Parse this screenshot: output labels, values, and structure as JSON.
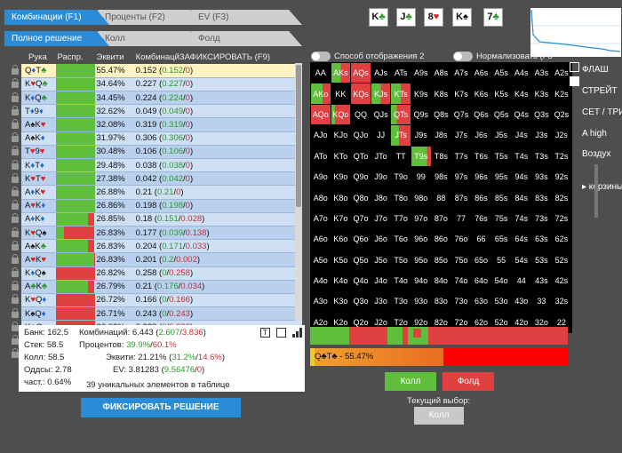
{
  "tabs": {
    "main": [
      {
        "label": "Комбинации (F1)",
        "active": true
      },
      {
        "label": "Проценты (F2)",
        "active": false
      },
      {
        "label": "EV (F3)",
        "active": false
      }
    ],
    "sub": [
      {
        "label": "Полное решение",
        "active": true
      },
      {
        "label": "Колл",
        "active": false
      },
      {
        "label": "Фолд",
        "active": false
      }
    ]
  },
  "board": [
    {
      "rank": "K",
      "suit": "♣",
      "color": "#2a9a2a"
    },
    {
      "rank": "J",
      "suit": "♣",
      "color": "#2a9a2a"
    },
    {
      "rank": "8",
      "suit": "♥",
      "color": "#d22"
    },
    {
      "rank": "K",
      "suit": "♠",
      "color": "#111"
    },
    {
      "rank": "7",
      "suit": "♣",
      "color": "#2a9a2a"
    }
  ],
  "table": {
    "headers": [
      "Рука",
      "Распр.",
      "Эквити",
      "КомбинацйЗАФИКСИРОВАТЬ (F9)"
    ],
    "rows": [
      [
        "Q♦T♣",
        "55.47%",
        "0.152",
        "0.152",
        "0",
        1.0,
        0
      ],
      [
        "K♥Q♣",
        "34.64%",
        "0.227",
        "0.227",
        "0",
        1.0,
        0
      ],
      [
        "K♦Q♣",
        "34.45%",
        "0.224",
        "0.224",
        "0",
        1.0,
        0
      ],
      [
        "T♦9♦",
        "32.62%",
        "0.049",
        "0.049",
        "0",
        1.0,
        0
      ],
      [
        "A♠K♥",
        "32.08%",
        "0.319",
        "0.319",
        "0",
        1.0,
        0
      ],
      [
        "A♠K♦",
        "31.97%",
        "0.306",
        "0.306",
        "0",
        1.0,
        0
      ],
      [
        "T♥9♥",
        "30.48%",
        "0.106",
        "0.106",
        "0",
        1.0,
        0
      ],
      [
        "K♦T♦",
        "29.48%",
        "0.038",
        "0.038",
        "0",
        1.0,
        0
      ],
      [
        "K♥T♥",
        "27.38%",
        "0.042",
        "0.042",
        "0",
        1.0,
        0
      ],
      [
        "A♦K♥",
        "26.88%",
        "0.21",
        "0.21",
        "0",
        1.0,
        0
      ],
      [
        "A♥K♦",
        "26.86%",
        "0.198",
        "0.198",
        "0",
        1.0,
        0
      ],
      [
        "A♦K♦",
        "26.85%",
        "0.18",
        "0.151",
        "0.028",
        0.84,
        0.16
      ],
      [
        "K♥Q♠",
        "26.83%",
        "0.177",
        "0.039",
        "0.138",
        0.22,
        0.78
      ],
      [
        "A♠K♣",
        "26.83%",
        "0.204",
        "0.171",
        "0.033",
        0.84,
        0.16
      ],
      [
        "A♥K♥",
        "26.83%",
        "0.201",
        "0.2",
        "0.002",
        0.99,
        0.01
      ],
      [
        "K♦Q♠",
        "26.82%",
        "0.258",
        "0",
        "0.258",
        0,
        1.0
      ],
      [
        "A♣K♣",
        "26.79%",
        "0.21",
        "0.176",
        "0.034",
        0.84,
        0.16
      ],
      [
        "K♥Q♦",
        "26.72%",
        "0.166",
        "0",
        "0.166",
        0,
        1.0
      ],
      [
        "K♠Q♦",
        "26.71%",
        "0.243",
        "0",
        "0.243",
        0,
        1.0
      ],
      [
        "K♣Q♦",
        "26.03%",
        "0.223",
        "0",
        "0.223",
        0,
        1.0
      ],
      [
        "K♣Q♥",
        "25.92%",
        "0.204",
        "0",
        "0.204",
        0,
        1.0
      ],
      [
        "A♥Q♥",
        "12.78%",
        "0.225",
        "0",
        "0.225",
        0,
        1.0
      ]
    ]
  },
  "grid": {
    "ranks": [
      "A",
      "K",
      "Q",
      "J",
      "T",
      "9",
      "8",
      "7",
      "6",
      "5",
      "4",
      "3",
      "2"
    ],
    "call": {
      "AA": 1,
      "AKs": 0.5,
      "AKo": 0.6,
      "AQs": 0,
      "AQo": 0,
      "KQs": 0,
      "KQo": 0.2,
      "KJs": 0.5,
      "KTs": 0.5,
      "QTs": 0.3,
      "T9s": 0.8,
      "JTs": 0.4
    },
    "colored": [
      "AKs",
      "AQs",
      "AKo",
      "KQs",
      "KJs",
      "KTs",
      "AQo",
      "KQo",
      "QTs",
      "T9s",
      "JTs"
    ]
  },
  "side_labels": [
    "ФЛАШ",
    "СТРЕЙТ",
    "СЕТ / ТРИ",
    "A high",
    "Воздух",
    "▸ корзины з"
  ],
  "toggles": [
    {
      "label": "Способ отображения 2"
    },
    {
      "label": "Нормализовать (F8"
    }
  ],
  "stats": {
    "bank": "Банк: 162.5",
    "stack": "Стек: 58.5",
    "call": "Колл: 58.5",
    "odds": "Оддсы: 2.78",
    "freq": "част.: 0.64%",
    "combos_label": "Комбинаций:",
    "combos_total": "6.443",
    "combos_call": "2.607",
    "combos_fold": "3.836",
    "pct_label": "Процентов:",
    "pct_call": "39.9%",
    "pct_fold": "60.1%",
    "eq_label": "Эквити:",
    "eq_total": "21.21%",
    "eq_call": "31.2%",
    "eq_fold": "14.6%",
    "ev_label": "EV:",
    "ev_total": "3.81283",
    "ev_call": "9.56476",
    "ev_fold": "0",
    "unique": "39 уникальных элементов в таблице"
  },
  "fix_button": "ФИКСИРОВАТЬ РЕШЕНИЕ",
  "selected_hand": "Q♣T♣ - 55.47%",
  "actions": {
    "call": "Колл",
    "fold": "Фолд",
    "current_label": "Текущий выбор:",
    "current_value": "Колл"
  },
  "colors": {
    "call": "#5fbf3c",
    "fold": "#e04040",
    "accent": "#2a8bd6"
  }
}
